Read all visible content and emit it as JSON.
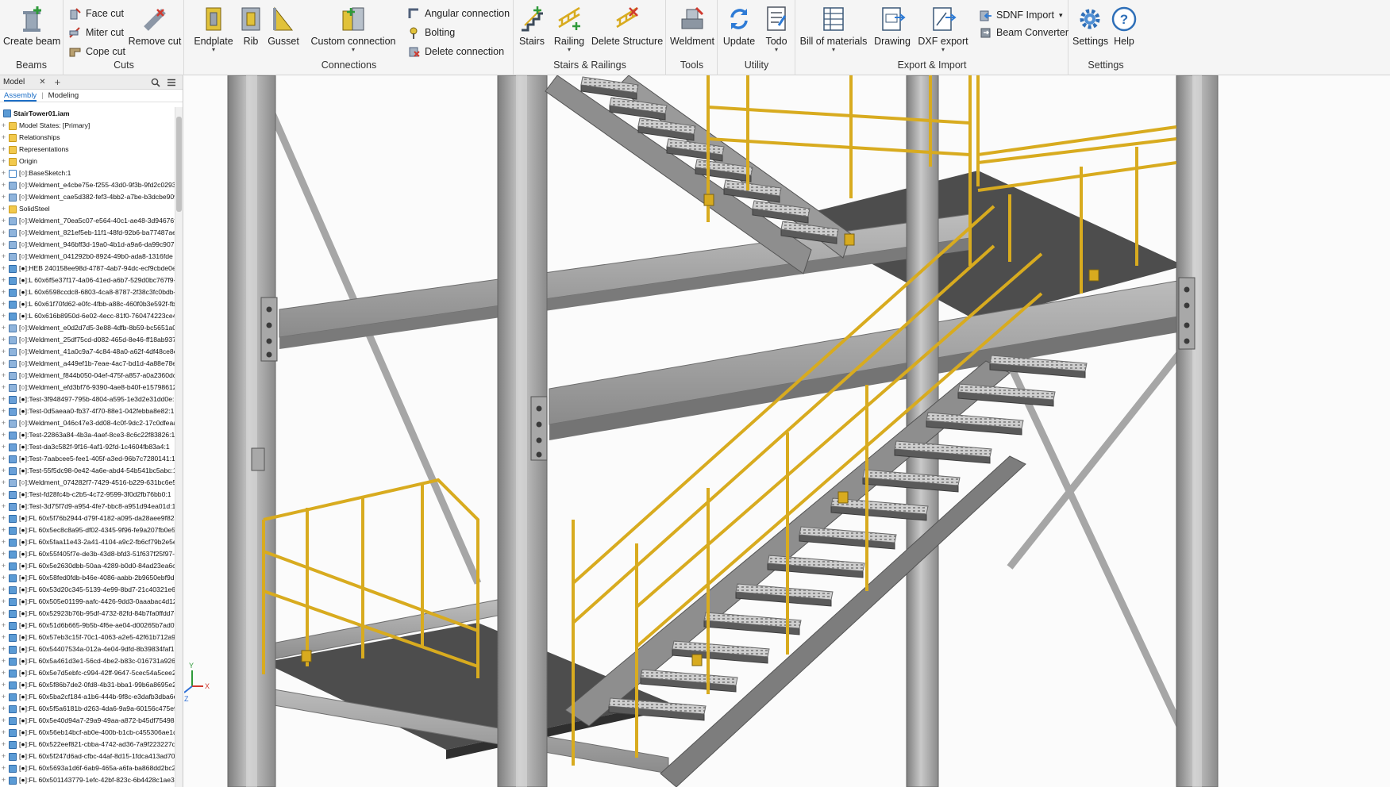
{
  "ribbon": {
    "groups": {
      "beams": "Beams",
      "cuts": "Cuts",
      "connections": "Connections",
      "stairs": "Stairs & Railings",
      "tools": "Tools",
      "utility": "Utility",
      "export": "Export & Import",
      "settings": "Settings"
    },
    "buttons": {
      "create_beam": "Create beam",
      "face_cut": "Face cut",
      "miter_cut": "Miter cut",
      "cope_cut": "Cope cut",
      "remove_cut": "Remove cut",
      "endplate": "Endplate",
      "rib": "Rib",
      "gusset": "Gusset",
      "custom_connection": "Custom connection",
      "angular_connection": "Angular connection",
      "bolting": "Bolting",
      "delete_connection": "Delete connection",
      "stairs": "Stairs",
      "railing": "Railing",
      "delete_structure": "Delete Structure",
      "weldment": "Weldment",
      "update": "Update",
      "todo": "Todo",
      "bill_of_materials": "Bill of materials",
      "drawing": "Drawing",
      "dxf_export": "DXF export",
      "sdnf_import": "SDNF Import",
      "beam_converter": "Beam Converter",
      "settings": "Settings",
      "help": "Help"
    },
    "dropdown_glyph": "▾"
  },
  "browser": {
    "model_tab": "Model",
    "close_glyph": "✕",
    "add_glyph": "+",
    "sub_tabs": [
      "Assembly",
      "Modeling"
    ],
    "root": "StairTower01.iam",
    "nodes": [
      {
        "icon": "folder",
        "text": "Model States: [Primary]"
      },
      {
        "icon": "folder",
        "text": "Relationships"
      },
      {
        "icon": "folder",
        "text": "Representations"
      },
      {
        "icon": "folder",
        "text": "Origin"
      },
      {
        "icon": "sketch",
        "text": "[○]:BaseSketch:1"
      },
      {
        "icon": "weld",
        "text": "[○]:Weldment_e4cbe75e-f255-43d0-9f3b-9fd2c0293"
      },
      {
        "icon": "weld",
        "text": "[○]:Weldment_cae5d382-fef3-4bb2-a7be-b3dcbe909"
      },
      {
        "icon": "folder",
        "text": "SolidSteel"
      },
      {
        "icon": "weld",
        "text": "[○]:Weldment_70ea5c07-e564-40c1-ae48-3d94676f7"
      },
      {
        "icon": "weld",
        "text": "[○]:Weldment_821ef5eb-11f1-48fd-92b6-ba77487ae"
      },
      {
        "icon": "weld",
        "text": "[○]:Weldment_946bff3d-19a0-4b1d-a9a6-da99c907b"
      },
      {
        "icon": "weld",
        "text": "[○]:Weldment_041292b0-8924-49b0-ada8-1316fde"
      },
      {
        "icon": "part",
        "text": "[●]:HEB 240158ee98d-4787-4ab7-94dc-ecf9cbde0e5"
      },
      {
        "icon": "part",
        "text": "[●]:L 60x6f5e37f17-4a06-41ed-a6b7-529d0bc767f9-"
      },
      {
        "icon": "part",
        "text": "[●]:L 60x6598ccdc8-6803-4ca8-8787-2f38c3fc0bdb-e"
      },
      {
        "icon": "part",
        "text": "[●]:L 60x61f70fd62-e0fc-4fbb-a88c-460f0b3e592f-fb"
      },
      {
        "icon": "part",
        "text": "[●]:L 60x616b8950d-6e02-4ecc-81f0-760474223ce4-"
      },
      {
        "icon": "weld",
        "text": "[○]:Weldment_e0d2d7d5-3e88-4dfb-8b59-bc5651a0"
      },
      {
        "icon": "weld",
        "text": "[○]:Weldment_25df75cd-d082-465d-8e46-ff18ab937"
      },
      {
        "icon": "weld",
        "text": "[○]:Weldment_41a0c9a7-4c84-48a0-a62f-4df48ce8e"
      },
      {
        "icon": "weld",
        "text": "[○]:Weldment_a449ef1b-7eae-4ac7-bd1d-4a88e78e5"
      },
      {
        "icon": "weld",
        "text": "[○]:Weldment_f844b050-04ef-475f-a857-a0a2360dc"
      },
      {
        "icon": "weld",
        "text": "[○]:Weldment_efd3bf76-9390-4ae8-b40f-e15798612"
      },
      {
        "icon": "test",
        "text": "[●]:Test-3f948497-795b-4804-a595-1e3d2e31dd0e:1"
      },
      {
        "icon": "test",
        "text": "[●]:Test-0d5aeaa0-fb37-4f70-88e1-042febba8e82:1"
      },
      {
        "icon": "weld",
        "text": "[○]:Weldment_046c47e3-dd08-4c0f-9dc2-17c0dfeaa3"
      },
      {
        "icon": "test",
        "text": "[●]:Test-22863a84-4b3a-4aef-8ce3-8c6c22f83826:1"
      },
      {
        "icon": "test",
        "text": "[●]:Test-da3c582f-9f16-4af1-92fd-1c4604fb83a4:1"
      },
      {
        "icon": "test",
        "text": "[●]:Test-7aabcee5-fee1-405f-a3ed-96b7c7280141:1"
      },
      {
        "icon": "test",
        "text": "[●]:Test-55f5dc98-0e42-4a6e-abd4-54b541bc5abc:1"
      },
      {
        "icon": "weld",
        "text": "[○]:Weldment_074282f7-7429-4516-b229-631bc6e5"
      },
      {
        "icon": "test",
        "text": "[●]:Test-fd28fc4b-c2b5-4c72-9599-3f0d2fb76bb0:1"
      },
      {
        "icon": "test",
        "text": "[●]:Test-3d75f7d9-a954-4fe7-bbc8-a951d94ea01d:1"
      },
      {
        "icon": "part",
        "text": "[●]:FL 60x5f76b2944-d79f-4182-a095-da28aee9f82a"
      },
      {
        "icon": "part",
        "text": "[●]:FL 60x5ec8c8a95-df02-4345-9f96-fe9a207fb0e5-"
      },
      {
        "icon": "part",
        "text": "[●]:FL 60x5faa11e43-2a41-4104-a9c2-fb6cf79b2e5e-"
      },
      {
        "icon": "part",
        "text": "[●]:FL 60x55f405f7e-de3b-43d8-bfd3-51f637f25f97-"
      },
      {
        "icon": "part",
        "text": "[●]:FL 60x5e2630dbb-50aa-4289-b0d0-84ad23ea6c4"
      },
      {
        "icon": "part",
        "text": "[●]:FL 60x58fed0fdb-b46e-4086-aabb-2b9650ebf9db"
      },
      {
        "icon": "part",
        "text": "[●]:FL 60x53d20c345-5139-4e99-8bd7-21c40321e6"
      },
      {
        "icon": "part",
        "text": "[●]:FL 60x505e01199-aafc-4426-9dd3-0aaabac4d125"
      },
      {
        "icon": "part",
        "text": "[●]:FL 60x52923b76b-95df-4732-82fd-84b7fa0ffdd7-"
      },
      {
        "icon": "part",
        "text": "[●]:FL 60x51d6b665-9b5b-4f6e-ae04-d00265b7ad0f"
      },
      {
        "icon": "part",
        "text": "[●]:FL 60x57eb3c15f-70c1-4063-a2e5-42f61b712a9"
      },
      {
        "icon": "part",
        "text": "[●]:FL 60x54407534a-012a-4e04-9dfd-8b39834faf16"
      },
      {
        "icon": "part",
        "text": "[●]:FL 60x5a461d3e1-56cd-4be2-b83c-016731a926d"
      },
      {
        "icon": "part",
        "text": "[●]:FL 60x5e7d5ebfc-c994-42ff-9647-5cec54a5cee2-a"
      },
      {
        "icon": "part",
        "text": "[●]:FL 60x5f86b7de2-0fd8-4b31-bba1-99b6a8695e2e"
      },
      {
        "icon": "part",
        "text": "[●]:FL 60x5ba2cf184-a1b6-444b-9f8c-e3dafb3dba6e-"
      },
      {
        "icon": "part",
        "text": "[●]:FL 60x5f5a6181b-d263-4da6-9a9a-60156c475e9"
      },
      {
        "icon": "part",
        "text": "[●]:FL 60x5e40d94a7-29a9-49aa-a872-b45df754985"
      },
      {
        "icon": "part",
        "text": "[●]:FL 60x56eb14bcf-ab0e-400b-b1cb-c455306ae1de"
      },
      {
        "icon": "part",
        "text": "[●]:FL 60x522eef821-cbba-4742-ad36-7a9f223227dc"
      },
      {
        "icon": "part",
        "text": "[●]:FL 60x5f247d6ad-cfbc-44af-8d15-1fdca413ad70-"
      },
      {
        "icon": "part",
        "text": "[●]:FL 60x5693a1d6f-6ab9-465a-a6fa-ba868dd2bc29"
      },
      {
        "icon": "part",
        "text": "[●]:FL 60x501143779-1efc-42bf-823c-6b4428c1ae36"
      }
    ]
  },
  "viewport": {
    "triad": {
      "x": "X",
      "y": "Y",
      "z": "Z"
    },
    "colors": {
      "steel": "#9c9c9c",
      "steel_dark": "#6e6e6e",
      "railing": "#d8ab1f",
      "grating": "#4d4d4d",
      "background": "#fbfbfb"
    }
  }
}
